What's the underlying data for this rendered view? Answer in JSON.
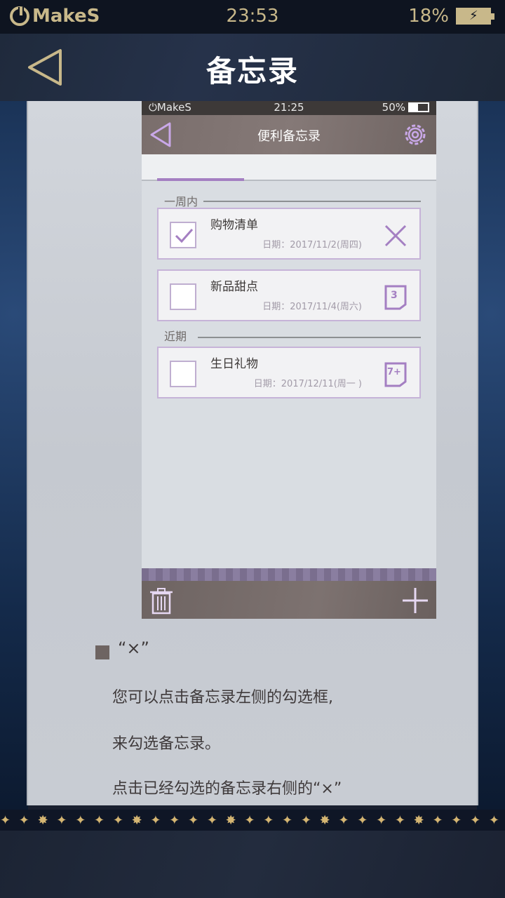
{
  "status_bar": {
    "brand": "MakeS",
    "time": "23:53",
    "battery": "18%"
  },
  "header": {
    "title": "备忘录"
  },
  "mockup": {
    "status": {
      "brand": "MakeS",
      "time": "21:25",
      "battery": "50%"
    },
    "title": "便利备忘录",
    "sections": [
      {
        "label": "一周内",
        "items": [
          {
            "title": "购物清单",
            "date": "日期：2017/11/2(周四)",
            "checked": true,
            "action": "close-icon"
          },
          {
            "title": "新品甜点",
            "date": "日期：2017/11/4(周六)",
            "checked": false,
            "action": "calendar-3-icon",
            "action_text": "3"
          }
        ]
      },
      {
        "label": "近期",
        "items": [
          {
            "title": "生日礼物",
            "date": "日期：2017/12/11(周一 )",
            "checked": false,
            "action": "calendar-7plus-icon",
            "action_text": "7+"
          }
        ]
      }
    ]
  },
  "help": {
    "heading": "“×”",
    "lines": [
      "您可以点击备忘录左侧的勾选框,",
      "来勾选备忘录。",
      "点击已经勾选的备忘录右侧的“×”"
    ]
  },
  "colors": {
    "accent_gold": "#c8b88a",
    "accent_purple": "#a47fc2",
    "header_brown": "#7a6e6c"
  },
  "decor": {
    "star_strip": "✦ ✦ ✸ ✦ ✦     ✦ ✦ ✸ ✦ ✦     ✦ ✦ ✸ ✦ ✦     ✦ ✦ ✸ ✦ ✦     ✦ ✦ ✸ ✦ ✦     ✦ ✦ ✸ ✦"
  }
}
